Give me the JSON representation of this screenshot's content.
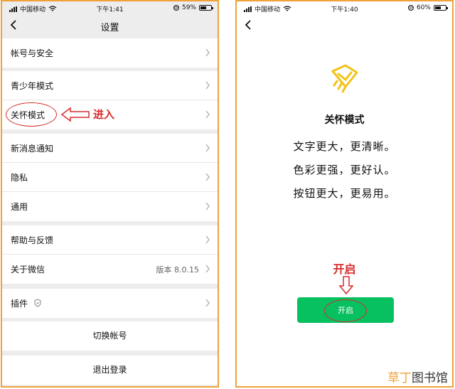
{
  "left": {
    "status": {
      "carrier": "中国移动",
      "time": "下午1:41",
      "battery": "59%",
      "battery_level": 0.59
    },
    "title": "设置",
    "groups": [
      [
        {
          "label": "帐号与安全"
        }
      ],
      [
        {
          "label": "青少年模式"
        },
        {
          "label": "关怀模式"
        }
      ],
      [
        {
          "label": "新消息通知"
        },
        {
          "label": "隐私"
        },
        {
          "label": "通用"
        }
      ],
      [
        {
          "label": "帮助与反馈"
        },
        {
          "label": "关于微信",
          "value": "版本 8.0.15"
        }
      ],
      [
        {
          "label": "插件"
        }
      ]
    ],
    "switch_account": "切换帐号",
    "logout": "退出登录",
    "annotation": "进入"
  },
  "right": {
    "status": {
      "carrier": "中国移动",
      "time": "下午1:40",
      "battery": "60%",
      "battery_level": 0.6
    },
    "mode_title": "关怀模式",
    "lines": [
      "文字更大，更清晰。",
      "色彩更强，更好认。",
      "按钮更大，更易用。"
    ],
    "annotation": "开启",
    "button": "开启"
  },
  "watermark": {
    "accent": "草丁",
    "rest": "图书馆"
  },
  "colors": {
    "accent_green": "#07c160",
    "annotation_red": "#d62b2b",
    "frame": "#f0a23a",
    "icon_yellow": "#f2c318"
  }
}
